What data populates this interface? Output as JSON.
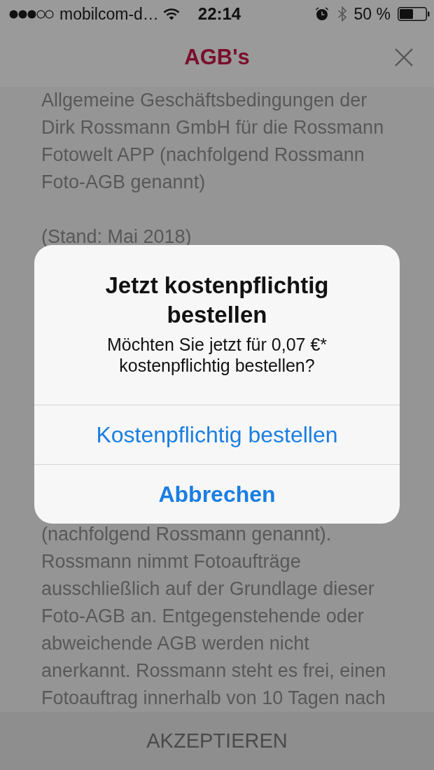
{
  "status_bar": {
    "carrier": "mobilcom-d…",
    "time": "22:14",
    "battery": "50 %"
  },
  "header": {
    "title": "AGB's"
  },
  "content": {
    "paragraphs": [
      "Allgemeine Geschäftsbedingungen der Dirk Rossmann GmbH für die Rossmann Fotowelt APP (nachfolgend Rossmann Foto-AGB genannt)",
      "(Stand: Mai 2018)",
      "(nachfolgend Rossmann genannt). Rossmann nimmt Fotoaufträge ausschließlich auf der Grundlage dieser Foto-AGB an. Entgegenstehende oder abweichende AGB werden nicht anerkannt. Rossmann steht es frei, einen Fotoauftrag innerhalb von 10 Tagen nach"
    ]
  },
  "footer": {
    "button": "AKZEPTIEREN"
  },
  "dialog": {
    "title": "Jetzt kostenpflichtig bestellen",
    "message": "Möchten Sie jetzt für 0,07 €* kostenpflichtig bestellen?",
    "actions": [
      {
        "label": "Kostenpflichtig bestellen",
        "kind": "confirm"
      },
      {
        "label": "Abbrechen",
        "kind": "cancel"
      }
    ]
  }
}
